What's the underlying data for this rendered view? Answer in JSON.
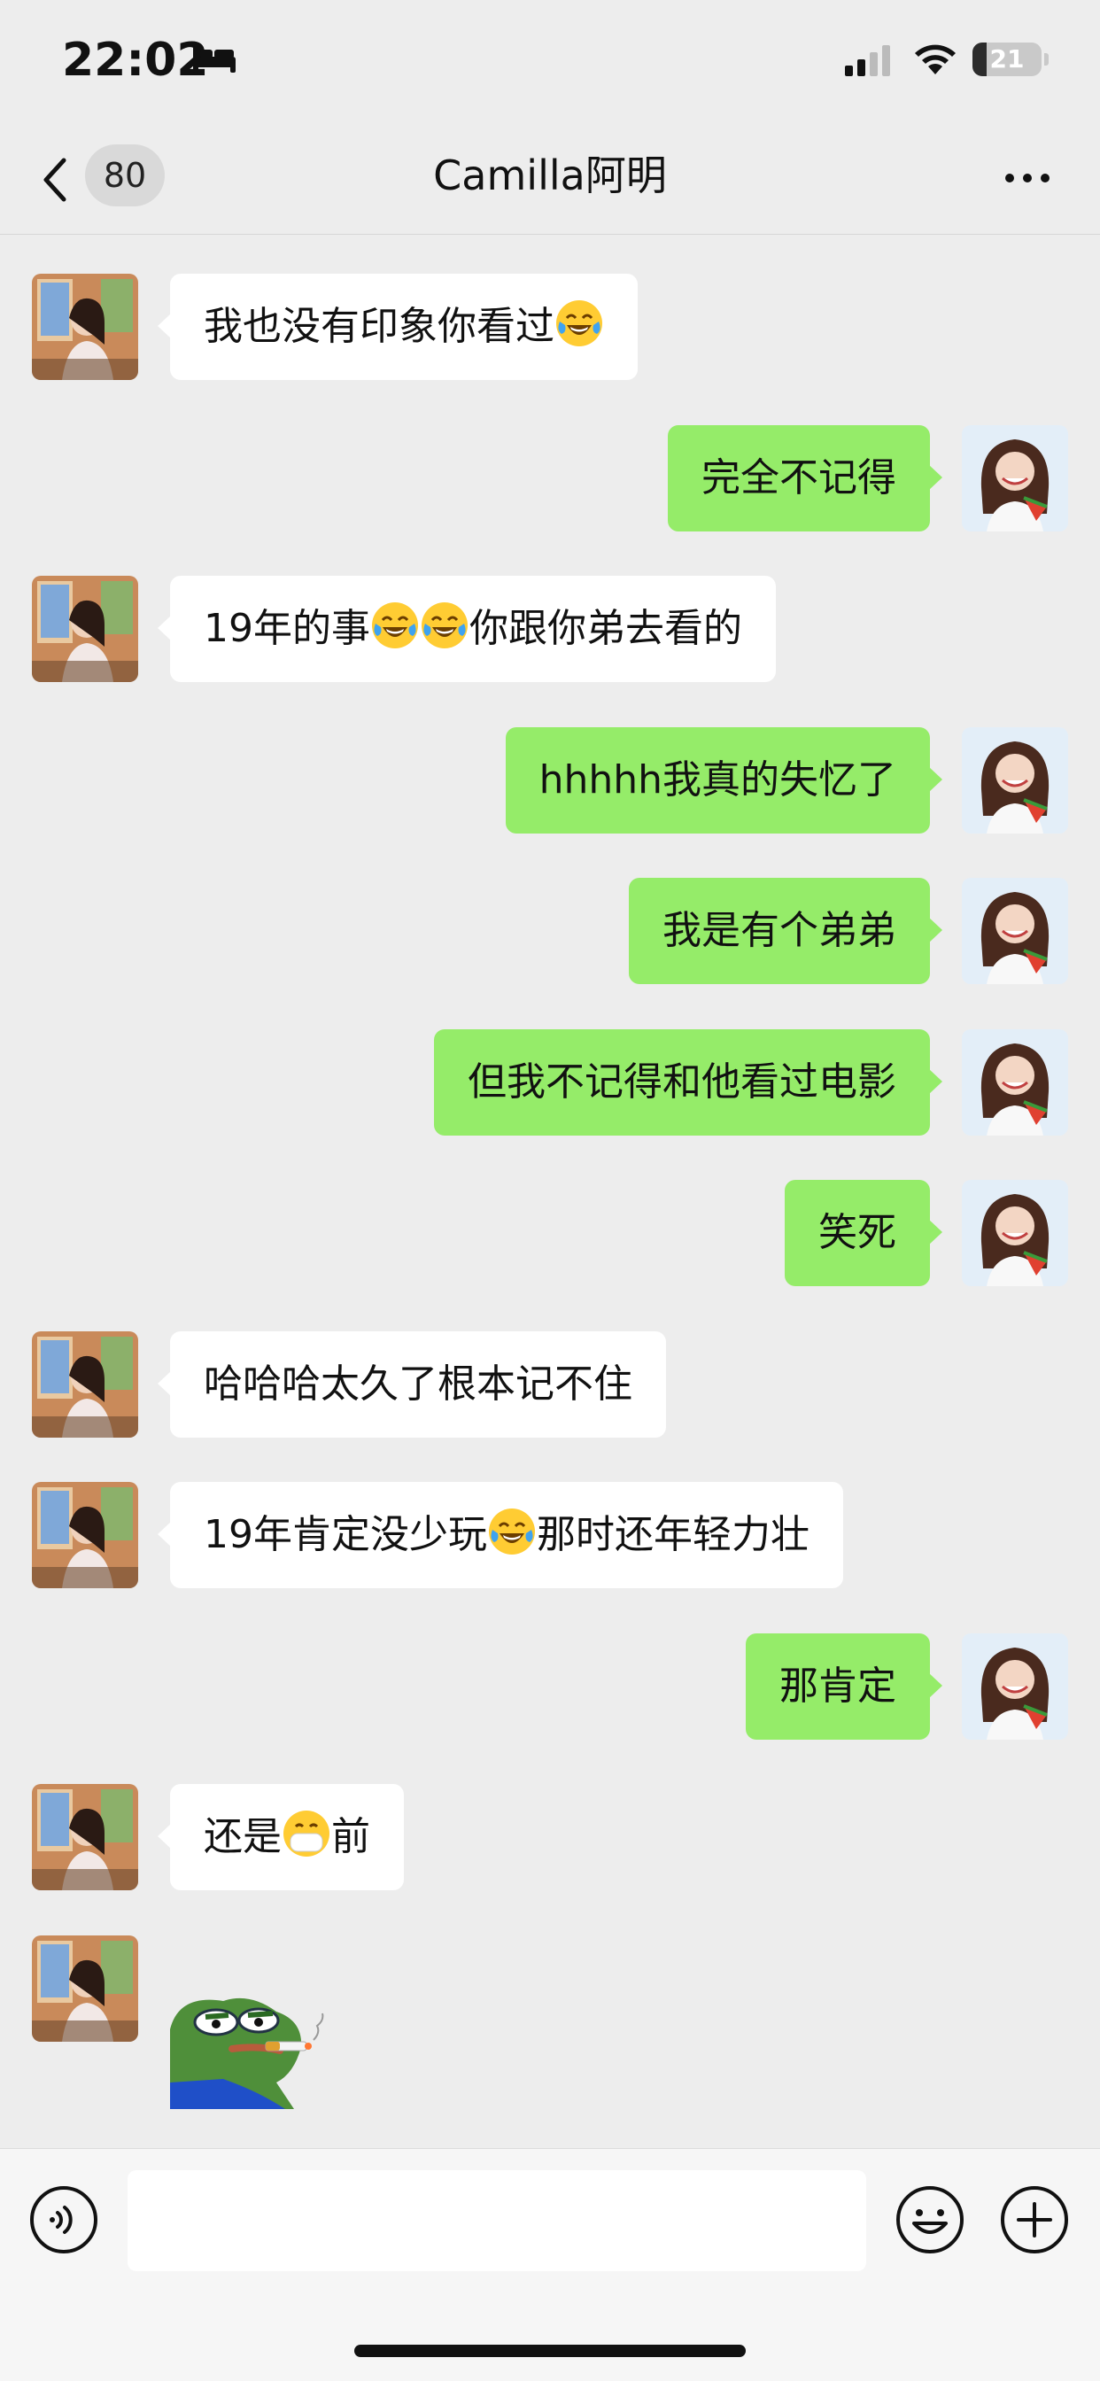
{
  "status_bar": {
    "time": "22:02",
    "battery_level": "21",
    "battery_fraction": 0.21,
    "icons": [
      "bed-icon",
      "cellular-signal-icon",
      "wifi-icon",
      "battery-icon"
    ]
  },
  "nav": {
    "unread_count": "80",
    "title": "Camilla阿明",
    "icons": [
      "chevron-left-icon",
      "more-icon"
    ]
  },
  "colors": {
    "background": "#ededed",
    "outgoing_bubble": "#95ec69",
    "incoming_bubble": "#ffffff"
  },
  "messages": [
    {
      "side": "in",
      "parts": [
        "我也没有印象你看过",
        "😂"
      ]
    },
    {
      "side": "out",
      "parts": [
        "完全不记得"
      ]
    },
    {
      "side": "in",
      "parts": [
        "19年的事",
        "😂",
        "😂",
        "你跟你弟去看的"
      ]
    },
    {
      "side": "out",
      "parts": [
        "hhhhh我真的失忆了"
      ]
    },
    {
      "side": "out",
      "parts": [
        "我是有个弟弟"
      ]
    },
    {
      "side": "out",
      "parts": [
        "但我不记得和他看过电影"
      ]
    },
    {
      "side": "out",
      "parts": [
        "笑死"
      ]
    },
    {
      "side": "in",
      "parts": [
        "哈哈哈太久了根本记不住"
      ]
    },
    {
      "side": "in",
      "parts": [
        "19年肯定没少玩",
        "😂",
        "那时还年轻力壮"
      ]
    },
    {
      "side": "out",
      "parts": [
        "那肯定"
      ]
    },
    {
      "side": "in",
      "parts": [
        "还是",
        "😷",
        "前"
      ]
    },
    {
      "side": "in",
      "sticker": "pepe-smoking-sticker"
    }
  ],
  "input_bar": {
    "placeholder": "",
    "value": "",
    "icons": [
      "voice-icon",
      "emoji-icon",
      "plus-icon"
    ]
  }
}
